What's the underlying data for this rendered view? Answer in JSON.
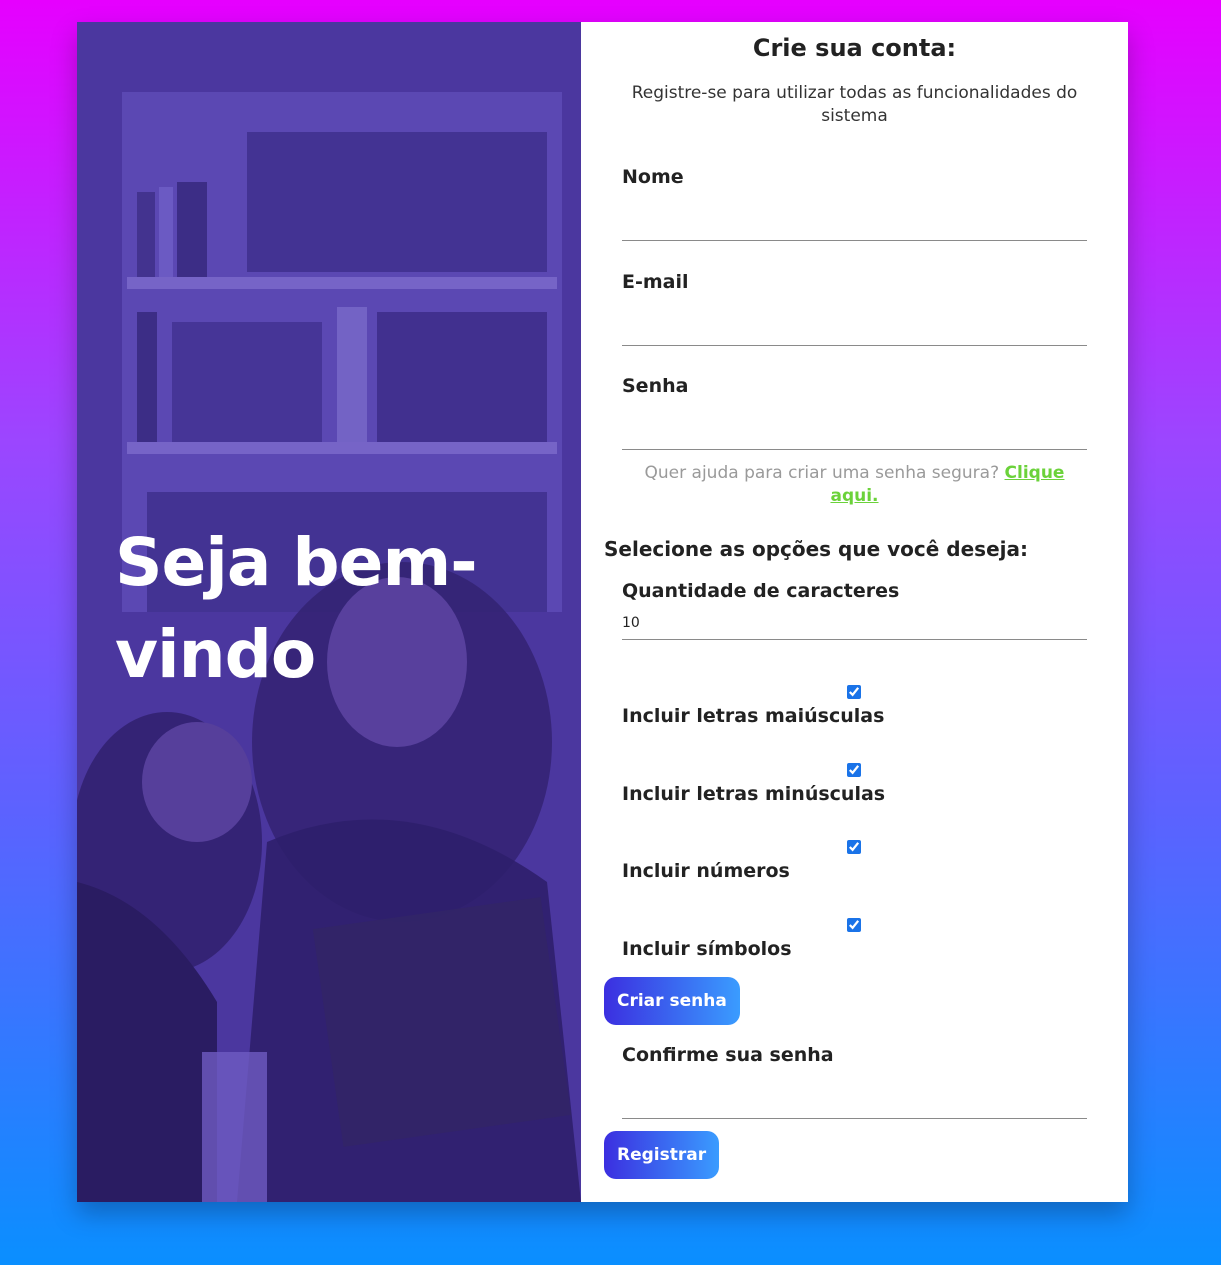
{
  "hero": {
    "title": "Seja bem-vindo"
  },
  "form": {
    "title": "Crie sua conta:",
    "subtitle": "Registre-se para utilizar todas as funcionalidades do sistema",
    "name_label": "Nome",
    "email_label": "E-mail",
    "password_label": "Senha",
    "help_text": "Quer ajuda para criar uma senha segura?",
    "help_link": "Clique aqui.",
    "options_title": "Selecione as opções que você deseja:",
    "length_label": "Quantidade de caracteres",
    "length_value": "10",
    "options": [
      {
        "label": "Incluir letras maiúsculas",
        "checked": true
      },
      {
        "label": "Incluir letras minúsculas",
        "checked": true
      },
      {
        "label": "Incluir números",
        "checked": true
      },
      {
        "label": "Incluir símbolos",
        "checked": true
      }
    ],
    "create_password_button": "Criar senha",
    "confirm_label": "Confirme sua senha",
    "register_button": "Registrar"
  },
  "colors": {
    "bg_top": "#e600ff",
    "bg_bottom": "#0a8fff",
    "overlay": "#4b3a9a",
    "link": "#6bd23a",
    "button_start": "#3b2fe0",
    "button_end": "#3a9cff"
  }
}
